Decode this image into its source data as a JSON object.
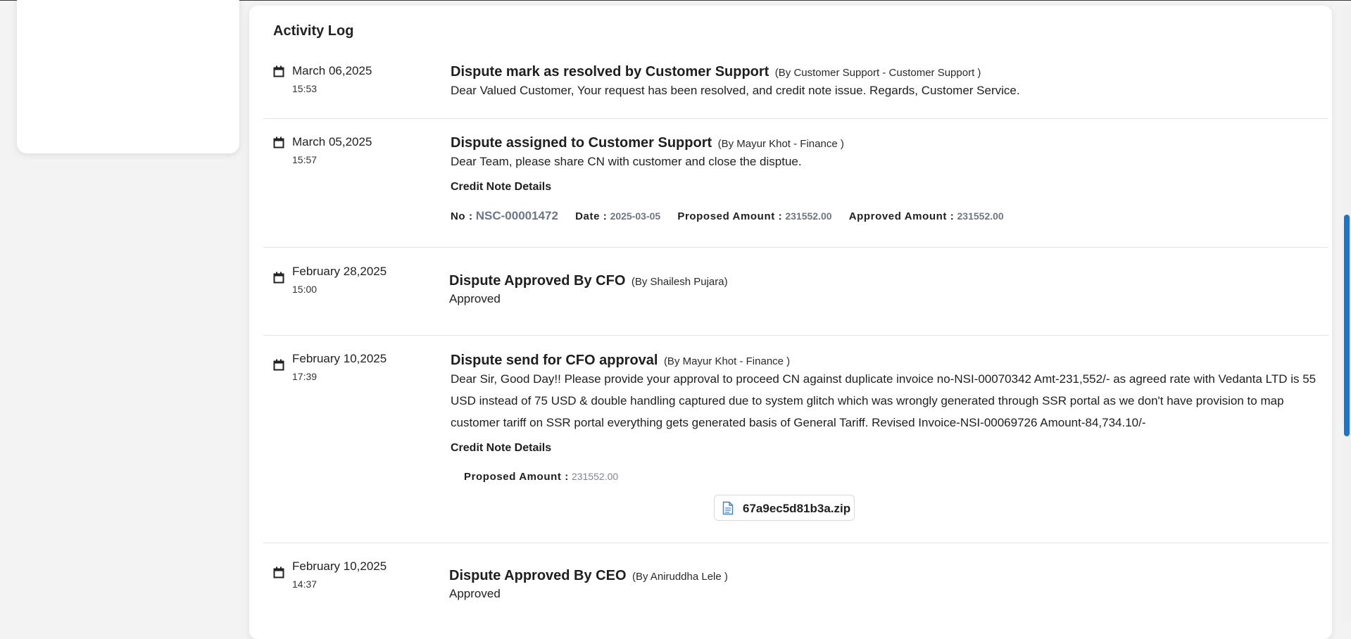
{
  "activity_log": {
    "title": "Activity Log",
    "credit_note_heading": "Credit Note Details",
    "entries": [
      {
        "date": "March 06,2025",
        "time": "15:53",
        "title": "Dispute mark as resolved by Customer Support",
        "by": "(By Customer Support - Customer Support )",
        "message": "Dear Valued Customer, Your request has been resolved, and credit note issue. Regards, Customer Service."
      },
      {
        "date": "March 05,2025",
        "time": "15:57",
        "title": "Dispute assigned to Customer Support",
        "by": "(By Mayur Khot - Finance )",
        "message": "Dear Team, please share CN with customer and close the disptue.",
        "credit_note": {
          "no_label": "No :",
          "no": "NSC-00001472",
          "date_label": "Date :",
          "date": "2025-03-05",
          "proposed_label": "Proposed Amount :",
          "proposed": "231552.00",
          "approved_label": "Approved Amount :",
          "approved": "231552.00"
        }
      },
      {
        "date": "February 28,2025",
        "time": "15:00",
        "title": "Dispute Approved By CFO",
        "by": "(By Shailesh Pujara)",
        "message": "Approved"
      },
      {
        "date": "February 10,2025",
        "time": "17:39",
        "title": "Dispute send for CFO approval",
        "by": "(By Mayur Khot - Finance )",
        "message": "Dear Sir, Good Day!! Please provide your approval to proceed CN against duplicate invoice no-NSI-00070342 Amt-231,552/- as agreed rate with Vedanta LTD is 55 USD instead of 75 USD & double handling captured due to system glitch which was wrongly generated through SSR portal as we don't have provision to map customer tariff on SSR portal everything gets generated basis of General Tariff. Revised Invoice-NSI-00069726 Amount-84,734.10/-",
        "credit_note": {
          "proposed_label": "Proposed Amount :",
          "proposed": "231552.00"
        },
        "attachment": "67a9ec5d81b3a.zip"
      },
      {
        "date": "February 10,2025",
        "time": "14:37",
        "title": "Dispute Approved By CEO",
        "by": "(By Aniruddha Lele )",
        "message": "Approved"
      }
    ]
  },
  "icons": {
    "calendar": "calendar-icon",
    "file": "file-icon"
  },
  "colors": {
    "accent": "#1b75c9",
    "muted_value": "#6c7685",
    "divider": "#e4e4e6"
  }
}
